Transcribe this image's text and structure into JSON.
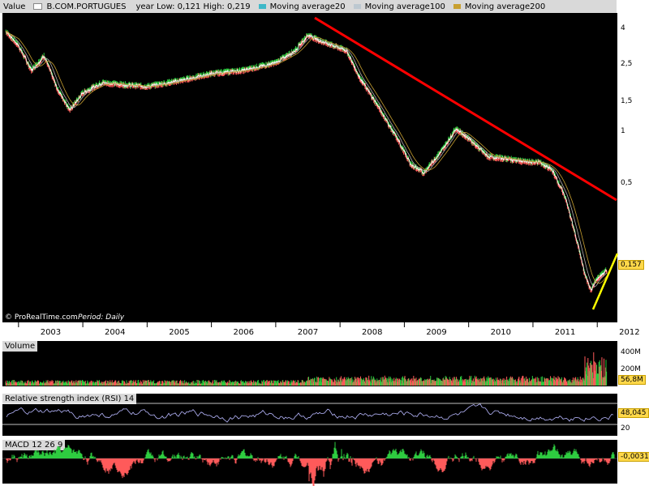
{
  "header": {
    "value_label": "Value",
    "instrument": "B.COM.PORTUGUES",
    "year_range": "year Low: 0,121 High: 0,219",
    "ma20": "Moving average20",
    "ma100": "Moving average100",
    "ma200": "Moving average200"
  },
  "colors": {
    "ma20": "#ffffff",
    "ma100": "#b0b0b0",
    "ma200": "#c8a030",
    "trend_down": "#ff0000",
    "trend_up": "#ffff00"
  },
  "footer": {
    "source": "© ProRealTime.com",
    "period": "Period: Daily"
  },
  "chart_data": [
    {
      "type": "line",
      "scale": "log",
      "y_ticks": [
        "4",
        "2,5",
        "1,5",
        "1",
        "0,5"
      ],
      "x_ticks": [
        "2003",
        "2004",
        "2005",
        "2006",
        "2007",
        "2008",
        "2009",
        "2010",
        "2011",
        "2012"
      ],
      "last_value": "0,157",
      "series": [
        {
          "x": [
            2002.8,
            2003.0,
            2003.2,
            2003.4,
            2003.6,
            2003.8,
            2004.0,
            2004.3,
            2004.6,
            2005.0,
            2005.5,
            2006.0,
            2006.5,
            2007.0,
            2007.3,
            2007.5,
            2007.7,
            2007.9,
            2008.1,
            2008.3,
            2008.6,
            2008.9,
            2009.1,
            2009.3,
            2009.6,
            2009.8,
            2010.0,
            2010.3,
            2010.6,
            2010.9,
            2011.1,
            2011.3,
            2011.5,
            2011.7,
            2011.8,
            2011.9,
            2012.0,
            2012.15
          ],
          "values": [
            3.9,
            3.2,
            2.3,
            2.8,
            1.8,
            1.35,
            1.7,
            1.95,
            1.9,
            1.85,
            2.0,
            2.2,
            2.3,
            2.55,
            3.0,
            3.7,
            3.4,
            3.2,
            3.0,
            2.1,
            1.4,
            0.9,
            0.65,
            0.58,
            0.8,
            1.05,
            0.92,
            0.72,
            0.7,
            0.67,
            0.67,
            0.6,
            0.42,
            0.22,
            0.15,
            0.12,
            0.14,
            0.157
          ]
        }
      ]
    },
    {
      "type": "bar",
      "title": "Volume",
      "y_ticks": [
        "400M",
        "200M"
      ],
      "last_value": "56,8M"
    },
    {
      "type": "line",
      "title": "Relative strength index (RSI) 14",
      "y_ticks": [
        "20"
      ],
      "last_value": "48,045"
    },
    {
      "type": "bar",
      "title": "MACD 12 26 9",
      "last_value": "-0,0031"
    }
  ]
}
